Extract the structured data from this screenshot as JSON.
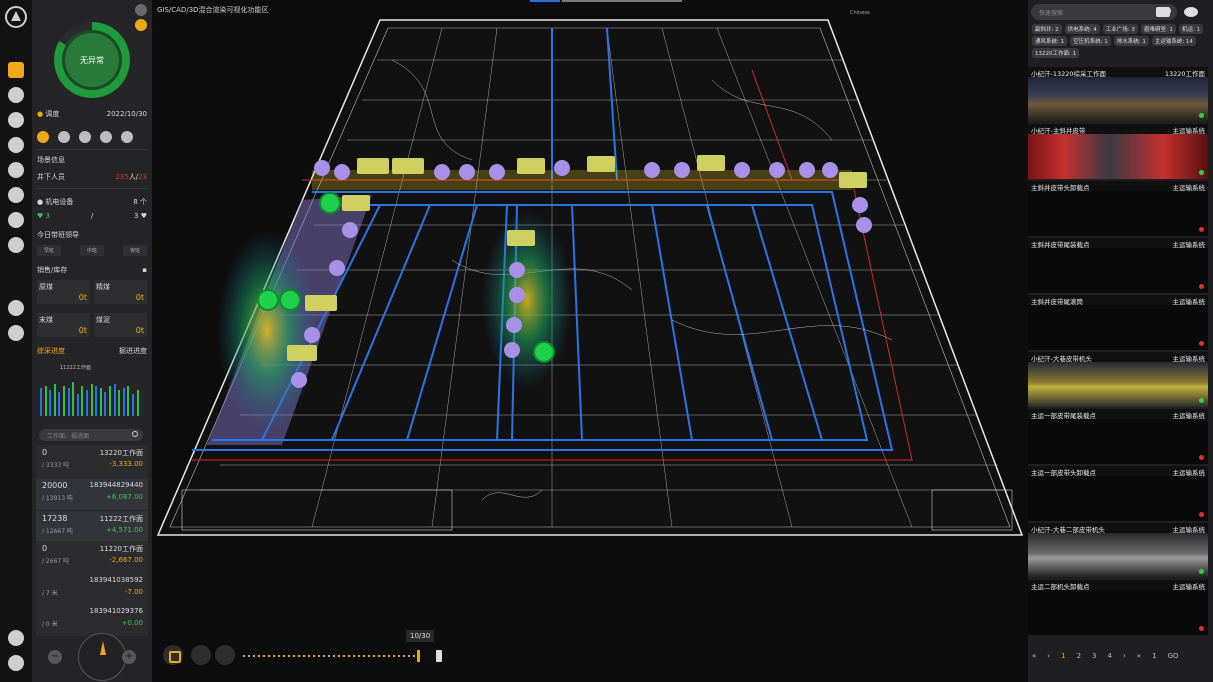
{
  "map": {
    "title": "GIS/CAD/3D混合渲染可视化功能区",
    "lang": "Chinese"
  },
  "left": {
    "status": "无异常",
    "dispatch_label": "调度",
    "date": "2022/10/30",
    "scene_title": "场景信息",
    "underground_label": "井下人员",
    "underground_count": "235",
    "underground_unit": "人/",
    "underground_extra": "23",
    "equipment_label": "机电设备",
    "equipment_count": "8",
    "equipment_unit": "个",
    "equipment_ok": "3",
    "equipment_slash": "/",
    "equipment_fav": "3",
    "leader_label": "今日带班领导",
    "shifts": [
      "早班",
      "中班",
      "夜班"
    ],
    "sales_label": "销售/库存",
    "coal": [
      {
        "name": "原煤",
        "value": "0t"
      },
      {
        "name": "精煤",
        "value": "0t"
      },
      {
        "name": "末煤",
        "value": "0t"
      },
      {
        "name": "煤泥",
        "value": "0t"
      }
    ],
    "progress_tabs": [
      "综采进度",
      "掘进进度"
    ],
    "chart_caption": "11222工作面",
    "search_placeholder": "工作面、掘进面",
    "records": [
      {
        "a": "0",
        "b": "/ 3333 吨",
        "c": "13220工作面",
        "d": "-3,333.00",
        "dc": "orange"
      },
      {
        "a": "20000",
        "b": "/ 13913 吨",
        "c": "183944829440",
        "d": "+6,087.00",
        "dc": "green"
      },
      {
        "a": "17238",
        "b": "/ 12667 吨",
        "c": "11222工作面",
        "d": "+4,571.00",
        "dc": "green"
      },
      {
        "a": "0",
        "b": "/ 2667 吨",
        "c": "11220工作面",
        "d": "-2,667.00",
        "dc": "orange"
      },
      {
        "a": "",
        "b": "/ 7 米",
        "c": "183941038592",
        "d": "-7.00",
        "dc": "orange"
      },
      {
        "a": "",
        "b": "/ 0 米",
        "c": "183941029376",
        "d": "+0.00",
        "dc": "green"
      }
    ]
  },
  "player": {
    "frame": "10/30"
  },
  "right": {
    "search_placeholder": "快速搜索",
    "chips": [
      "副斜井: 2",
      "供电系统: 4",
      "工业广场: 3",
      "避难硐室: 1",
      "机运: 1",
      "通风系统: 1",
      "空压机系统: 1",
      "排水系统: 1",
      "主运输系统: 14",
      "13220工作面: 1"
    ],
    "cams": [
      {
        "name": "小纪汗-13220综采工作面",
        "sys": "13220工作面",
        "live": true,
        "status": "green"
      },
      {
        "name": "小纪汗-主斜井皮带",
        "sys": "主运输系统",
        "live": true,
        "status": "green"
      },
      {
        "name": "主斜井皮带头卸载点",
        "sys": "主运输系统",
        "live": false,
        "status": "red"
      },
      {
        "name": "主斜井皮带尾装载点",
        "sys": "主运输系统",
        "live": false,
        "status": "red"
      },
      {
        "name": "主斜井皮带尾滚筒",
        "sys": "主运输系统",
        "live": false,
        "status": "red"
      },
      {
        "name": "小纪汗-大巷皮带机头",
        "sys": "主运输系统",
        "live": true,
        "status": "green"
      },
      {
        "name": "主运一部皮带尾装载点",
        "sys": "主运输系统",
        "live": false,
        "status": "red"
      },
      {
        "name": "主运一部皮带头卸载点",
        "sys": "主运输系统",
        "live": false,
        "status": "red"
      },
      {
        "name": "小纪汗-大巷二部皮带机头",
        "sys": "主运输系统",
        "live": true,
        "status": "green"
      },
      {
        "name": "主运二部机头卸载点",
        "sys": "主运输系统",
        "live": false,
        "status": "red"
      }
    ],
    "pages": [
      "1",
      "2",
      "3",
      "4"
    ],
    "page_jump": "1",
    "go": "GO"
  },
  "colors": {
    "accent": "#f0a818",
    "ok": "#1fa83c",
    "bad": "#e0302a",
    "panel": "#252527"
  }
}
